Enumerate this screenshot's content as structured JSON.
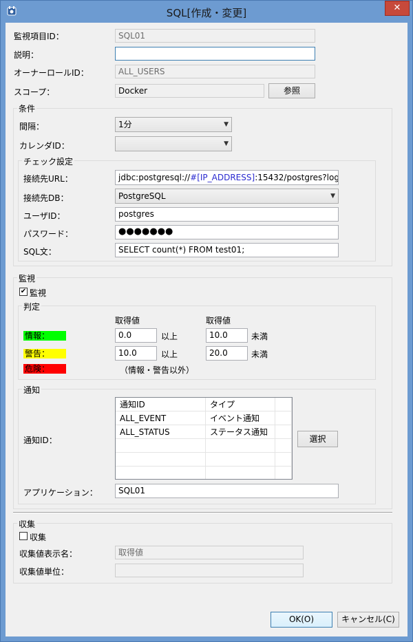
{
  "window": {
    "title": "SQL[作成・変更]",
    "close_label": "✕"
  },
  "fields": {
    "monitor_id_label": "監視項目ID：",
    "monitor_id": "SQL01",
    "description_label": "説明：",
    "description": "",
    "owner_role_label": "オーナーロールID：",
    "owner_role": "ALL_USERS",
    "scope_label": "スコープ：",
    "scope": "Docker",
    "browse_label": "参照"
  },
  "condition": {
    "title": "条件",
    "interval_label": "間隔：",
    "interval": "1分",
    "calendar_label": "カレンダID：",
    "calendar": ""
  },
  "check": {
    "title": "チェック設定",
    "url_label": "接続先URL：",
    "url_prefix": "jdbc:postgresql://",
    "url_addr": "#[IP_ADDRESS]",
    "url_suffix": ":15432/postgres?log",
    "db_label": "接続先DB：",
    "db": "PostgreSQL",
    "user_label": "ユーザID：",
    "user": "postgres",
    "password_label": "パスワード：",
    "password": "●●●●●●●",
    "sql_label": "SQL文：",
    "sql": "SELECT count(*) FROM test01;"
  },
  "monitor": {
    "title": "監視",
    "enable_label": "監視",
    "enabled": true,
    "judge_title": "判定",
    "col1_header": "取得値",
    "col2_header": "取得値",
    "info_label": "情報：",
    "info_from": "0.0",
    "info_to": "10.0",
    "warn_label": "警告：",
    "warn_from": "10.0",
    "warn_to": "20.0",
    "crit_label": "危険：",
    "crit_note": "（情報・警告以外）",
    "above_label": "以上",
    "below_label": "未満",
    "info_color": "#00ff00",
    "warn_color": "#ffff00",
    "crit_color": "#ff0000"
  },
  "notify": {
    "title": "通知",
    "id_label": "通知ID：",
    "headers": [
      "通知ID",
      "タイプ"
    ],
    "rows": [
      [
        "ALL_EVENT",
        "イベント通知"
      ],
      [
        "ALL_STATUS",
        "ステータス通知"
      ]
    ],
    "select_label": "選択",
    "app_label": "アプリケーション：",
    "app": "SQL01"
  },
  "collect": {
    "title": "収集",
    "enable_label": "収集",
    "enabled": false,
    "display_label": "収集値表示名：",
    "display": "取得値",
    "unit_label": "収集値単位：",
    "unit": ""
  },
  "footer": {
    "ok_label": "OK(O)",
    "cancel_label": "キャンセル(C)"
  }
}
